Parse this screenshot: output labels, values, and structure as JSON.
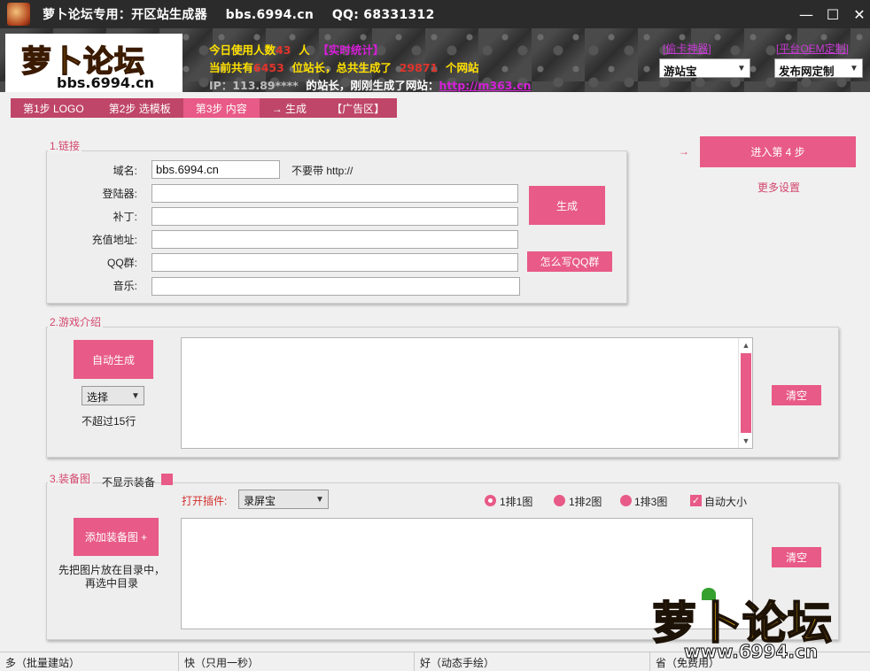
{
  "window": {
    "title": "萝卜论坛专用：开区站生成器    bbs.6994.cn    QQ: 68331312",
    "minimize": "—",
    "maximize": "☐",
    "close": "✕"
  },
  "banner": {
    "logo_text": "萝卜论坛",
    "logo_url": "bbs.6994.cn",
    "line1_a": "今日使用人数",
    "line1_num": "43",
    "line1_b": "  人  ",
    "line1_link": "【实时统计】",
    "line2_a": "当前共有",
    "line2_num1": "6453",
    "line2_b": "  位站长，总共生成了  ",
    "line2_num2": "29871",
    "line2_c": "  个网站",
    "line3_ip": "IP：113.89****",
    "line3_b": "  的站长，刚刚生成了网站：",
    "line3_link": "http://m363.cn",
    "link_tools": "[偷卡神器]",
    "link_oem": "[平台OEM定制]",
    "select_left": "游站宝",
    "select_right": "发布网定制"
  },
  "tabs": [
    {
      "label": "第1步 LOGO"
    },
    {
      "label": "第2步 选模板"
    },
    {
      "label": "第3步 内容"
    },
    {
      "label": "→ 生成"
    },
    {
      "label": "【广告区】"
    }
  ],
  "section_link": {
    "legend": "1.链接",
    "labels": [
      "域名:",
      "登陆器:",
      "补丁:",
      "充值地址:",
      "QQ群:",
      "音乐:"
    ],
    "domain_value": "bbs.6994.cn",
    "domain_hint": "不要带 http://",
    "generate_button": "生成",
    "qq_help_button": "怎么写QQ群"
  },
  "right_side": {
    "arrow": "→",
    "next_step_button": "进入第 4 步",
    "more_settings": "更多设置"
  },
  "section_intro": {
    "legend": "2.游戏介绍",
    "auto_button": "自动生成",
    "select_value": "选择",
    "limit_text": "不超过15行",
    "clear_button": "清空"
  },
  "section_equip": {
    "legend": "3.装备图",
    "hide_label": "不显示装备",
    "plugin_label": "打开插件:",
    "plugin_value": "录屏宝",
    "radio_1": "1排1图",
    "radio_2": "1排2图",
    "radio_3": "1排3图",
    "auto_size": "自动大小",
    "add_button": "添加装备图 +",
    "hint_line1": "先把图片放在目录中，",
    "hint_line2": "再选中目录",
    "clear_button": "清空"
  },
  "status_bar": [
    "多（批量建站）",
    "快（只用一秒）",
    "好（动态手绘）",
    "省（免费用）"
  ],
  "watermark": {
    "main": "萝卜论坛",
    "sub": "www.6994.cn"
  },
  "colors": {
    "accent": "#e85a87",
    "tab_bg": "#bf4668",
    "legend": "#d3476e",
    "banner_text": "#ffe000"
  }
}
